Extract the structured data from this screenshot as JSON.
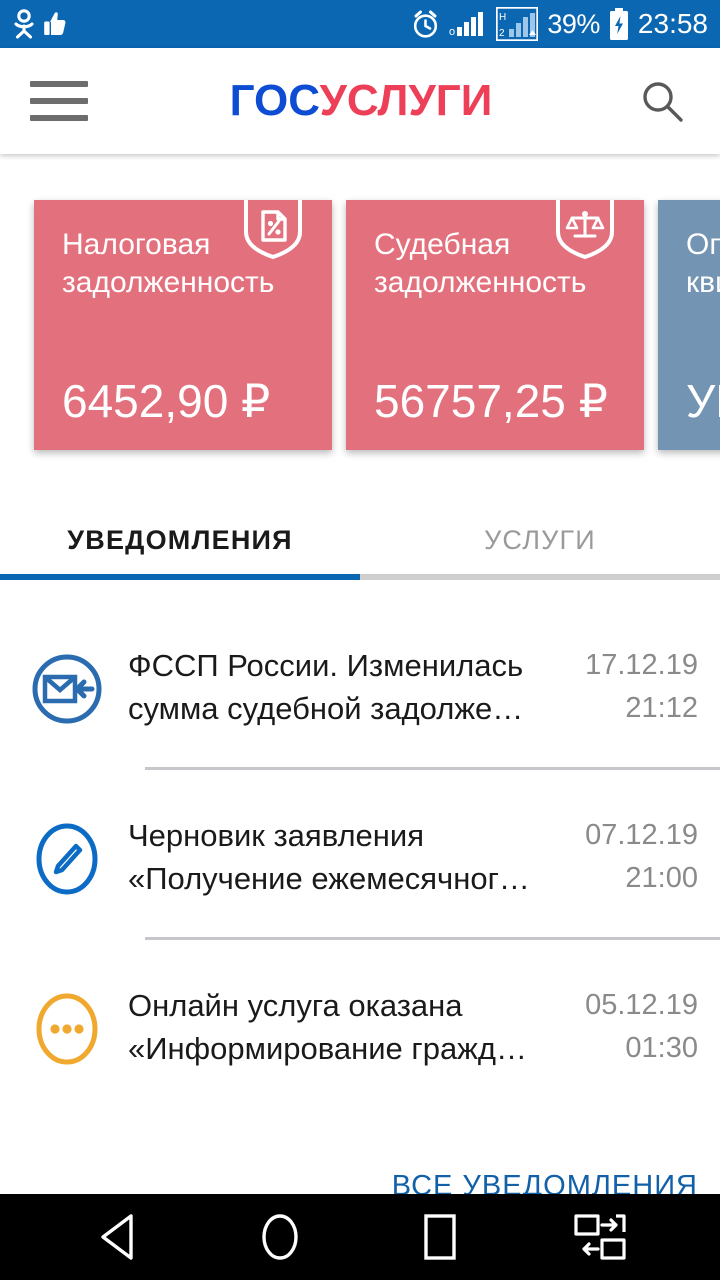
{
  "statusbar": {
    "left_icons": [
      "odnoklassniki-icon",
      "thumbs-up-icon"
    ],
    "right_icons": [
      "alarm-clock-icon",
      "signal-sim1-icon",
      "signal-sim2-hsdpa-icon",
      "battery-charging-icon"
    ],
    "battery_percent": "39%",
    "clock": "23:58"
  },
  "header": {
    "menu_icon": "hamburger-menu-icon",
    "logo_part1": "ГОС",
    "logo_part2": "УСЛУГИ",
    "search_icon": "search-icon"
  },
  "cards": [
    {
      "title": "Налоговая задолженность",
      "value": "6452,90 ₽",
      "icon": "tax-document-percent-shield-icon",
      "color": "#E3707D",
      "kind": "debt"
    },
    {
      "title": "Судебная задолженность",
      "value": "56757,25 ₽",
      "icon": "scales-of-justice-shield-icon",
      "color": "#E3707D",
      "kind": "debt"
    },
    {
      "title": "Оплата по квитанции",
      "value": "УИН",
      "icon": "receipt-shield-icon",
      "color": "#7394B2",
      "kind": "uin"
    }
  ],
  "tabs": [
    {
      "label": "УВЕДОМЛЕНИЯ",
      "active": true
    },
    {
      "label": "УСЛУГИ",
      "active": false
    }
  ],
  "notifications": [
    {
      "text": "ФССП России. Изменилась сумма судебной задолже…",
      "date": "17.12.19",
      "time": "21:12",
      "icon": "incoming-mail-icon",
      "icon_color": "#2B6CB0"
    },
    {
      "text": "Черновик заявления «Получение ежемесячног…",
      "date": "07.12.19",
      "time": "21:00",
      "icon": "pencil-draft-icon",
      "icon_color": "#0C6BC4"
    },
    {
      "text": "Онлайн услуга оказана «Информирование гражд…",
      "date": "05.12.19",
      "time": "01:30",
      "icon": "three-dots-in-progress-icon",
      "icon_color": "#F0A82E"
    }
  ],
  "all_notifications_link": "ВСЕ УВЕДОМЛЕНИЯ",
  "navbar": {
    "back": "back-triangle-icon",
    "home": "home-circle-icon",
    "recents": "recents-square-icon",
    "split": "split-screen-icon"
  },
  "colors": {
    "status_blue": "#0B67B2",
    "accent_blue": "#0B67B2",
    "logo_blue": "#0D4CD3",
    "logo_red": "#EE3F58",
    "card_red": "#E3707D",
    "card_blue_gray": "#7394B2",
    "link_blue": "#1160A8"
  }
}
